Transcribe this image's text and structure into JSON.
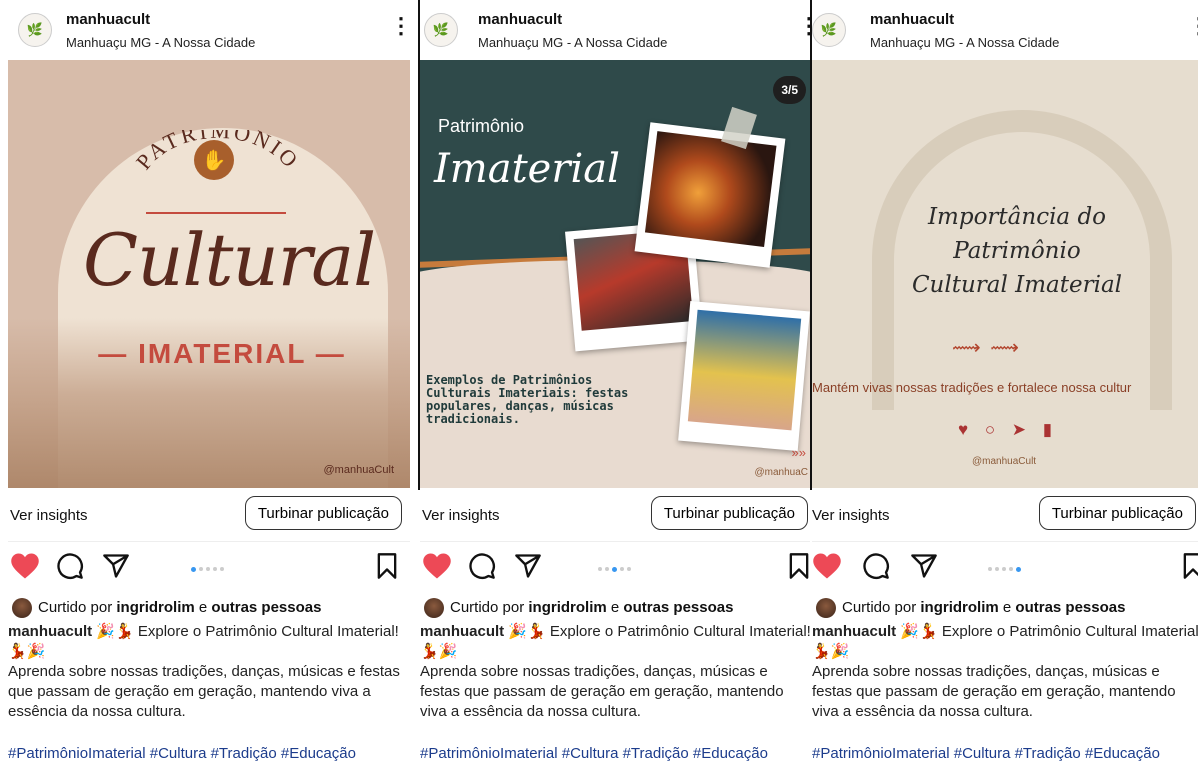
{
  "posts": [
    {
      "username": "manhuacult",
      "location": "Manhuaçu MG - A Nossa Cidade",
      "image": {
        "title_top": "PATRIMÔNIO",
        "title_main": "Cultural",
        "title_sub": "— IMATERIAL —",
        "handle": "@manhuaCult"
      },
      "carousel_active_index": 0,
      "carousel_count": 5,
      "insights_label": "Ver insights",
      "boost_label": "Turbinar publicação",
      "liked_prefix": "Curtido por",
      "liked_user": "ingridrolim",
      "liked_suffix": "e",
      "liked_others": "outras pessoas",
      "caption_user": "manhuacult",
      "caption_line1": "🎉💃 Explore o Patrimônio Cultural Imaterial!",
      "caption_line1b": "💃🎉",
      "caption_body": "Aprenda sobre nossas tradições, danças, músicas e festas que passam de geração em geração, mantendo viva a essência da nossa cultura.",
      "hashtags": "#PatrimônioImaterial #Cultura #Tradição #Educação"
    },
    {
      "username": "manhuacult",
      "location": "Manhuaçu MG - A Nossa Cidade",
      "image": {
        "counter": "3/5",
        "title_top": "Patrimônio",
        "title_main": "Imaterial",
        "body": "Exemplos de Patrimônios Culturais Imateriais: festas populares, danças, músicas tradicionais.",
        "handle": "@manhuaC",
        "arrows": "»»"
      },
      "carousel_active_index": 2,
      "carousel_count": 5,
      "insights_label": "Ver insights",
      "boost_label": "Turbinar publicação",
      "liked_prefix": "Curtido por",
      "liked_user": "ingridrolim",
      "liked_suffix": "e",
      "liked_others": "outras pessoas",
      "caption_user": "manhuacult",
      "caption_line1": "🎉💃 Explore o Patrimônio Cultural Imaterial!",
      "caption_line1b": "💃🎉",
      "caption_body": "Aprenda sobre nossas tradições, danças, músicas e festas que passam de geração em geração, mantendo viva a essência da nossa cultura.",
      "hashtags": "#PatrimônioImaterial #Cultura #Tradição #Educação"
    },
    {
      "username": "manhuacult",
      "location": "Manhuaçu MG - A Nossa Cidade",
      "image": {
        "title_line1": "Importância do",
        "title_line2": "Patrimônio",
        "title_line3": "Cultural Imaterial",
        "flourish": "⟿ ⟿",
        "tagline": "Mantém vivas nossas tradições e fortalece nossa cultur",
        "icons": "♥ ○ ➤ ▮",
        "handle": "@manhuaCult"
      },
      "carousel_active_index": 4,
      "carousel_count": 5,
      "insights_label": "Ver insights",
      "boost_label": "Turbinar publicação",
      "liked_prefix": "Curtido por",
      "liked_user": "ingridrolim",
      "liked_suffix": "e",
      "liked_others": "outras pessoas",
      "caption_user": "manhuacult",
      "caption_line1": "🎉💃 Explore o Patrimônio Cultural Imaterial",
      "caption_line1b": "💃🎉",
      "caption_body": "Aprenda sobre nossas tradições, danças, músicas e festas que passam de geração em geração, mantendo viva a essência da nossa cultura.",
      "hashtags": "#PatrimônioImaterial #Cultura #Tradição #Educação"
    }
  ],
  "icons": {
    "heart": "heart-icon",
    "comment": "comment-icon",
    "send": "send-icon",
    "bookmark": "bookmark-icon",
    "more": "more-vertical-icon"
  },
  "colors": {
    "like": "#ed4956",
    "active_dot": "#3897f0",
    "hashtag": "#1c3c8c",
    "post1_bg": "#d7bcaa",
    "post2_teal": "#2f4a4a",
    "post3_bg": "#e6ddcf"
  }
}
